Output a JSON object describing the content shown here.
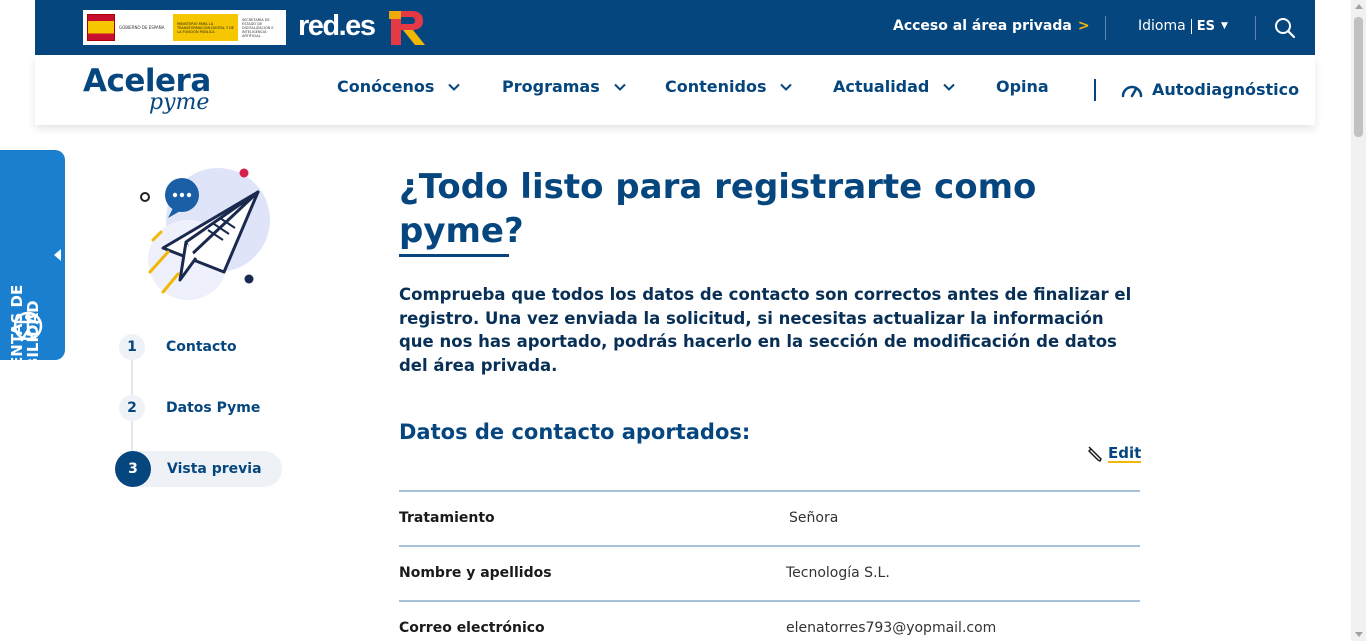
{
  "topbar": {
    "gov_logo": {
      "line1": "GOBIERNO DE ESPAÑA",
      "line2": "MINISTERIO PARA LA TRANSFORMACIÓN DIGITAL Y DE LA FUNCIÓN PÚBLICA",
      "line3": "SECRETARÍA DE ESTADO DE DIGITALIZACIÓN E INTELIGENCIA ARTIFICIAL"
    },
    "redes_logo": "red.es",
    "private_area_link": "Acceso al área privada",
    "private_area_chevron": ">",
    "language_label": "Idioma",
    "language_value": "ES"
  },
  "nav": {
    "logo_main": "Acelera",
    "logo_sub": "pyme",
    "items": [
      {
        "label": "Conócenos",
        "dropdown": true
      },
      {
        "label": "Programas",
        "dropdown": true
      },
      {
        "label": "Contenidos",
        "dropdown": true
      },
      {
        "label": "Actualidad",
        "dropdown": true
      },
      {
        "label": "Opina",
        "dropdown": false
      }
    ],
    "autodiagnostico": "Autodiagnóstico"
  },
  "accessibility": {
    "line1": "HERRAMIENTAS DE",
    "line2": "ACCESIBILIDAD"
  },
  "steps": [
    {
      "number": "1",
      "label": "Contacto",
      "active": false
    },
    {
      "number": "2",
      "label": "Datos Pyme",
      "active": false
    },
    {
      "number": "3",
      "label": "Vista previa",
      "active": true
    }
  ],
  "main": {
    "title": "¿Todo listo para registrarte como pyme?",
    "lead": "Comprueba que todos los datos de contacto son correctos antes de finalizar el registro. Una vez enviada la solicitud, si necesitas actualizar la información que nos has aportado, podrás hacerlo en la sección de modificación de datos del área privada.",
    "section_title": "Datos de contacto aportados:",
    "edit_label": "Edit",
    "rows": [
      {
        "key": "Tratamiento",
        "value": "Señora"
      },
      {
        "key": "Nombre y apellidos",
        "value": "Tecnología S.L."
      },
      {
        "key": "Correo electrónico",
        "value": "elenatorres793@yopmail.com"
      }
    ]
  },
  "colors": {
    "primary": "#06467f",
    "accent": "#f2b705",
    "accessibility_tab": "#1a7fcf"
  }
}
